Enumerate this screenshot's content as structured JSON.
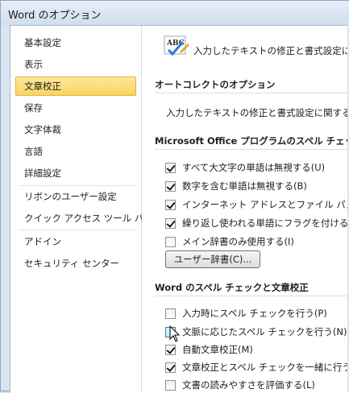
{
  "window": {
    "title": "Word のオプション"
  },
  "sidebar": {
    "items": [
      {
        "label": "基本設定"
      },
      {
        "label": "表示"
      },
      {
        "label": "文章校正"
      },
      {
        "label": "保存"
      },
      {
        "label": "文字体裁"
      },
      {
        "label": "言語"
      },
      {
        "label": "詳細設定"
      },
      {
        "label": "リボンのユーザー設定"
      },
      {
        "label": "クイック アクセス ツール バー"
      },
      {
        "label": "アドイン"
      },
      {
        "label": "セキュリティ センター"
      }
    ],
    "selected": "文章校正"
  },
  "main": {
    "intro_text": "入力したテキストの修正と書式設定に関",
    "autocorrect": {
      "header": "オートコレクトのオプション",
      "text": "入力したテキストの修正と書式設定に関するオプ"
    },
    "office_spell": {
      "header": "Microsoft Office プログラムのスペル チェック",
      "options": [
        {
          "label": "すべて大文字の単語は無視する(U)",
          "checked": true
        },
        {
          "label": "数字を含む単語は無視する(B)",
          "checked": true
        },
        {
          "label": "インターネット アドレスとファイル パスは無視す",
          "checked": true
        },
        {
          "label": "繰り返し使われる単語にフラグを付ける(R)",
          "checked": true
        },
        {
          "label": "メイン辞書のみ使用する(I)",
          "checked": false
        }
      ],
      "dictionary_button": "ユーザー辞書(C)..."
    },
    "word_spell": {
      "header": "Word のスペル チェックと文章校正",
      "options": [
        {
          "label": "入力時にスペル チェックを行う(P)",
          "checked": false
        },
        {
          "label": "文脈に応じたスペル チェックを行う(N)",
          "checked": false
        },
        {
          "label": "自動文章校正(M)",
          "checked": true
        },
        {
          "label": "文章校正とスペル チェックを一緒に行う(H)",
          "checked": true
        },
        {
          "label": "文書の読みやすさを評価する(L)",
          "checked": false
        }
      ]
    }
  },
  "icons": {
    "proofing": "abc-check-icon",
    "pointer": "mouse-cursor-icon"
  }
}
